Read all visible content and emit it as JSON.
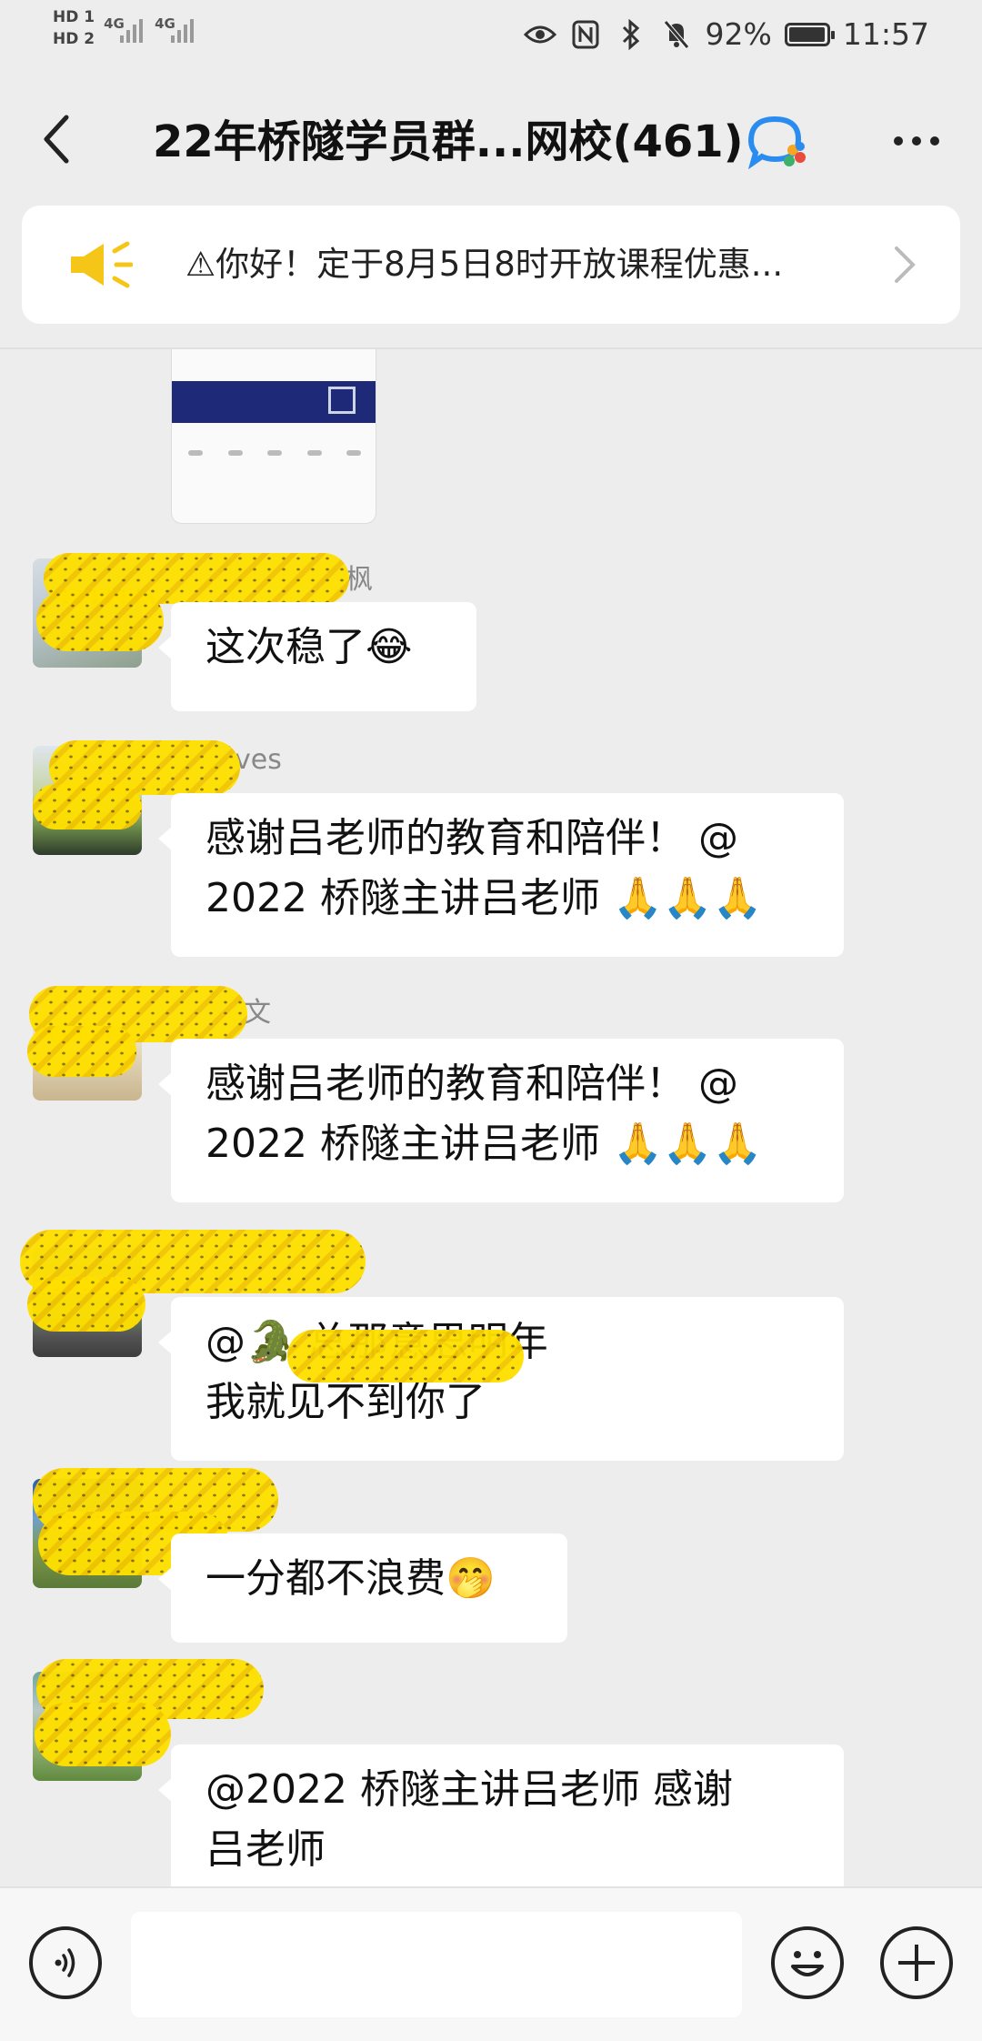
{
  "status_bar": {
    "hd1": "HD 1",
    "hd2": "HD 2",
    "sim1_network": "4G",
    "sim2_network": "4G",
    "battery": "92%",
    "time": "11:57"
  },
  "header": {
    "title": "22年桥隧学员群...网校(461)",
    "group_icon": "wecom-group-icon"
  },
  "announcement": {
    "text": "⚠你好！定于8月5日8时开放课程优惠...",
    "icon": "megaphone-icon"
  },
  "messages": [
    {
      "sender_visible": "枫",
      "lines": [
        "这次稳了😂"
      ]
    },
    {
      "sender_visible": "ves",
      "lines": [
        "感谢吕老师的教育和陪伴！ @",
        "2022 桥隧主讲吕老师 🙏🙏🙏"
      ]
    },
    {
      "sender_visible": "文",
      "lines": [
        "感谢吕老师的教育和陪伴！ @",
        "2022 桥隧主讲吕老师 🙏🙏🙏"
      ]
    },
    {
      "sender_visible": "",
      "lines": [
        "@🐊        总那意思明年",
        "我就见不到你了"
      ]
    },
    {
      "sender_visible": "",
      "lines": [
        "一分都不浪费🤭"
      ]
    },
    {
      "sender_visible": "",
      "lines": [
        "@2022 桥隧主讲吕老师  感谢",
        "吕老师"
      ]
    }
  ],
  "input_bar": {
    "placeholder": ""
  },
  "colors": {
    "background": "#ededed",
    "bubble": "#ffffff",
    "mask_yellow": "#ffe000",
    "speaker_yellow": "#f5c518"
  }
}
